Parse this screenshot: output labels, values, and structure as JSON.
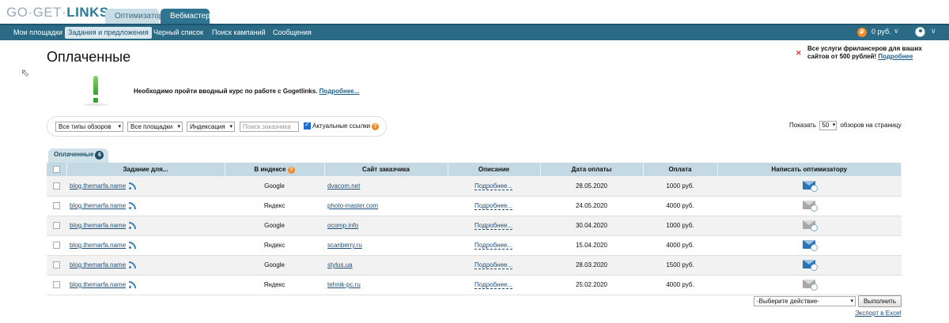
{
  "logo": {
    "part1": "GO·GET·",
    "part2": "LINKS"
  },
  "role_tabs": [
    {
      "label": "Оптимизатор"
    },
    {
      "label": "Вебмастер"
    }
  ],
  "nav": {
    "items": [
      {
        "label": "Мои площадки"
      },
      {
        "label": "Задания и предложения"
      },
      {
        "label": "Черный список"
      },
      {
        "label": "Поиск кампаний"
      },
      {
        "label": "Сообщения"
      }
    ],
    "coin_symbol": "₽",
    "balance": "0 руб."
  },
  "page_title": "Оплаченные",
  "promo": {
    "text": "Все услуги фрилансеров для ваших сайтов от 500 рублей!",
    "link": "Подробнее"
  },
  "notice": {
    "text": "Необходимо пройти вводный курс по работе с Gogetlinks.",
    "link": "Подробнее..."
  },
  "filters": {
    "review_type": "Все типы обзоров",
    "sites": "Все площадки",
    "indexation": "Индексация",
    "search_placeholder": "Поиск заказчика",
    "actual_links_label": "Актуальные ссылки",
    "actual_links_checked": true
  },
  "per_page": {
    "prefix": "Показать",
    "value": "50",
    "suffix": "обзоров на страницу"
  },
  "status_tab": {
    "label": "Оплаченные",
    "count": "6"
  },
  "table": {
    "headers": [
      "Задание для...",
      "В индексе",
      "Сайт заказчика",
      "Описание",
      "Дата оплаты",
      "Оплата",
      "Написать оптимизатору"
    ],
    "rows": [
      {
        "site": "blog.themarfa.name",
        "index": "Google",
        "customer": "dvacom.net",
        "desc": "Подробнее...",
        "date": "28.05.2020",
        "pay": "1000 руб.",
        "mail": "active"
      },
      {
        "site": "blog.themarfa.name",
        "index": "Яндекс",
        "customer": "photo-master.com",
        "desc": "Подробнее...",
        "date": "24.05.2020",
        "pay": "4000 руб.",
        "mail": "inactive"
      },
      {
        "site": "blog.themarfa.name",
        "index": "Google",
        "customer": "ocomp.info",
        "desc": "Подробнее...",
        "date": "30.04.2020",
        "pay": "1000 руб.",
        "mail": "inactive"
      },
      {
        "site": "blog.themarfa.name",
        "index": "Яндекс",
        "customer": "scanberry.ru",
        "desc": "Подробнее...",
        "date": "15.04.2020",
        "pay": "4000 руб.",
        "mail": "active"
      },
      {
        "site": "blog.themarfa.name",
        "index": "Google",
        "customer": "stylus.ua",
        "desc": "Подробнее...",
        "date": "28.03.2020",
        "pay": "1500 руб.",
        "mail": "active"
      },
      {
        "site": "blog.themarfa.name",
        "index": "Яндекс",
        "customer": "tehnik-pc.ru",
        "desc": "Подробнее...",
        "date": "25.02.2020",
        "pay": "4000 руб.",
        "mail": "inactive"
      }
    ]
  },
  "actions": {
    "select_value": "-Выберите действие-",
    "submit_label": "Выполнить",
    "export_label": "Экспорт в Excel"
  }
}
